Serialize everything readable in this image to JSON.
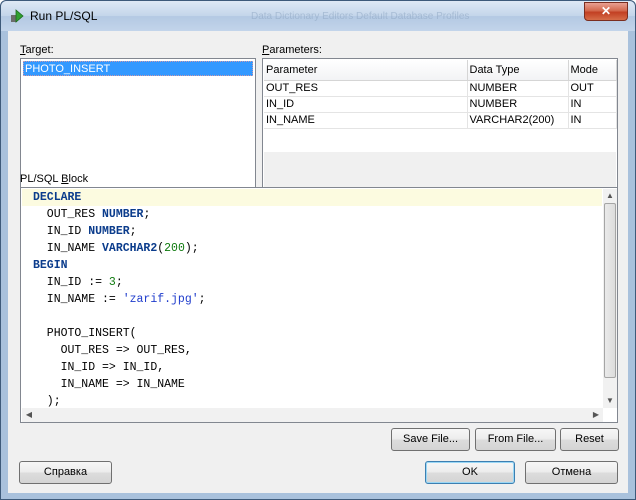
{
  "window": {
    "title": "Run PL/SQL",
    "title_ghost": "Data Dictionary Editors Default Database Profiles",
    "close_symbol": "✕"
  },
  "target": {
    "label_prefix": "",
    "label_underlined": "T",
    "label_rest": "arget:",
    "items": [
      "PHOTO_INSERT"
    ]
  },
  "parameters": {
    "label_underlined": "P",
    "label_rest": "arameters:",
    "columns": [
      "Parameter",
      "Data Type",
      "Mode"
    ],
    "rows": [
      [
        "OUT_RES",
        "NUMBER",
        "OUT"
      ],
      [
        "IN_ID",
        "NUMBER",
        "IN"
      ],
      [
        "IN_NAME",
        "VARCHAR2(200)",
        "IN"
      ]
    ]
  },
  "plsql": {
    "label_prefix": "PL/SQL ",
    "label_underlined": "B",
    "label_rest": "lock",
    "lines": [
      "DECLARE",
      "  OUT_RES NUMBER;",
      "  IN_ID NUMBER;",
      "  IN_NAME VARCHAR2(200);",
      "BEGIN",
      "  IN_ID := 3;",
      "  IN_NAME := 'zarif.jpg';",
      "",
      "  PHOTO_INSERT(",
      "    OUT_RES => OUT_RES,",
      "    IN_ID => IN_ID,",
      "    IN_NAME => IN_NAME",
      "  );"
    ]
  },
  "buttons": {
    "save_file": "Save File...",
    "from_file": "From File...",
    "reset": "Reset",
    "help": "Справка",
    "ok": "OK",
    "cancel": "Отмена"
  },
  "colors": {
    "selection": "#3399ff",
    "keyword": "#0b3c8c",
    "number_literal": "#0e7a0e",
    "string_literal": "#1f3ccc",
    "current_line": "#fcfbe0"
  }
}
